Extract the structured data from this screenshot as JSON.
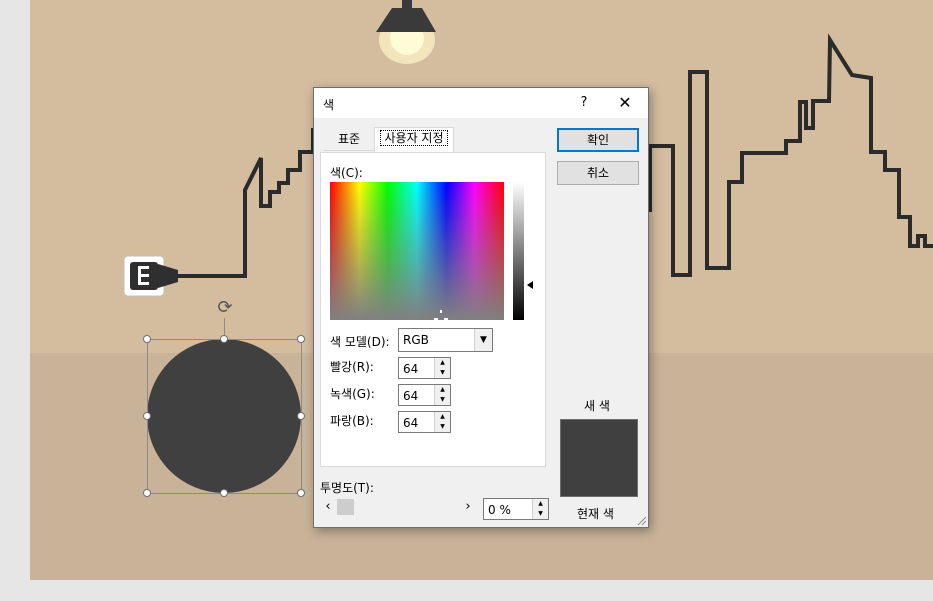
{
  "colors": {
    "shape_fill": "#404040",
    "accent": "#0078d7",
    "wall": "#d4bc9f",
    "floor": "#c8b398",
    "outline": "#2b2b2b"
  },
  "slide": {
    "icons": [
      "ceiling-lamp-icon",
      "city-skyline-line-icon",
      "power-plug-icon",
      "rotate-handle-icon"
    ]
  },
  "dialog": {
    "title": "색",
    "help": "?",
    "close_icon": "close-icon",
    "tabs": [
      {
        "label": "표준",
        "active": false
      },
      {
        "label": "사용자 지정",
        "active": true
      }
    ],
    "ok_label": "확인",
    "cancel_label": "취소",
    "colors_label": "색(C):",
    "color_model": {
      "label": "색 모델(D):",
      "value": "RGB"
    },
    "red": {
      "label": "빨강(R):",
      "value": "64"
    },
    "green": {
      "label": "녹색(G):",
      "value": "64"
    },
    "blue": {
      "label": "파랑(B):",
      "value": "64"
    },
    "transparency": {
      "label": "투명도(T):",
      "value": "0 %"
    },
    "new_label": "새 색",
    "current_label": "현재 색"
  }
}
